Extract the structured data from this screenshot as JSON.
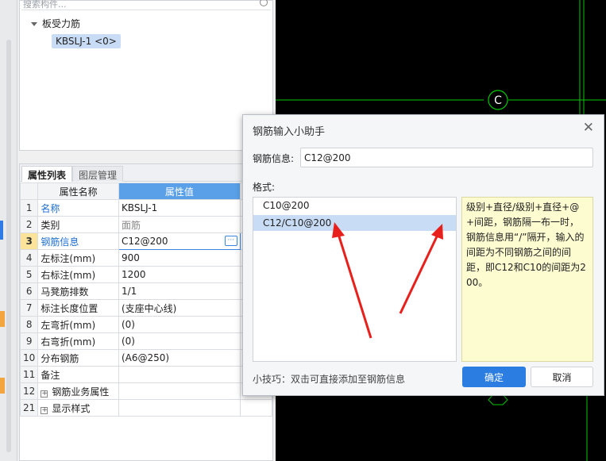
{
  "tree": {
    "search_placeholder": "搜索构件...",
    "group_label": "板受力筋",
    "selected_item": "KBSLJ-1 <0>"
  },
  "prop_panel": {
    "tabs": [
      {
        "label": "属性列表"
      },
      {
        "label": "图层管理"
      }
    ],
    "header_name": "属性名称",
    "header_value": "属性值",
    "rows": [
      {
        "num": "1",
        "name": "名称",
        "value": "KBSLJ-1"
      },
      {
        "num": "2",
        "name": "类别",
        "value": "面筋"
      },
      {
        "num": "3",
        "name": "钢筋信息",
        "value": "C12@200"
      },
      {
        "num": "4",
        "name": "左标注(mm)",
        "value": "900"
      },
      {
        "num": "5",
        "name": "右标注(mm)",
        "value": "1200"
      },
      {
        "num": "6",
        "name": "马凳筋排数",
        "value": "1/1"
      },
      {
        "num": "7",
        "name": "标注长度位置",
        "value": "(支座中心线)"
      },
      {
        "num": "8",
        "name": "左弯折(mm)",
        "value": "(0)"
      },
      {
        "num": "9",
        "name": "右弯折(mm)",
        "value": "(0)"
      },
      {
        "num": "10",
        "name": "分布钢筋",
        "value": "(A6@250)"
      },
      {
        "num": "11",
        "name": "备注",
        "value": ""
      },
      {
        "num": "12",
        "name": "钢筋业务属性",
        "value": ""
      },
      {
        "num": "21",
        "name": "显示样式",
        "value": ""
      }
    ]
  },
  "cad": {
    "axis_label": "C"
  },
  "dialog": {
    "title": "钢筋输入小助手",
    "info_label": "钢筋信息:",
    "info_value": "C12@200",
    "format_label": "格式:",
    "formats": [
      "C10@200",
      "C12/C10@200"
    ],
    "selected_format_index": 1,
    "hint": "级别+直径/级别+直径+@+间距，钢筋隔一布一时，钢筋信息用“/”隔开，输入的间距为不同钢筋之间的间距，即C12和C10的间距为200。",
    "tip": "小技巧：双击可直接添加至钢筋信息",
    "ok_label": "确定",
    "cancel_label": "取消"
  },
  "colors": {
    "accent": "#2b7de1",
    "annotation_arrow": "#e8201c",
    "cad_line": "#00c800"
  }
}
